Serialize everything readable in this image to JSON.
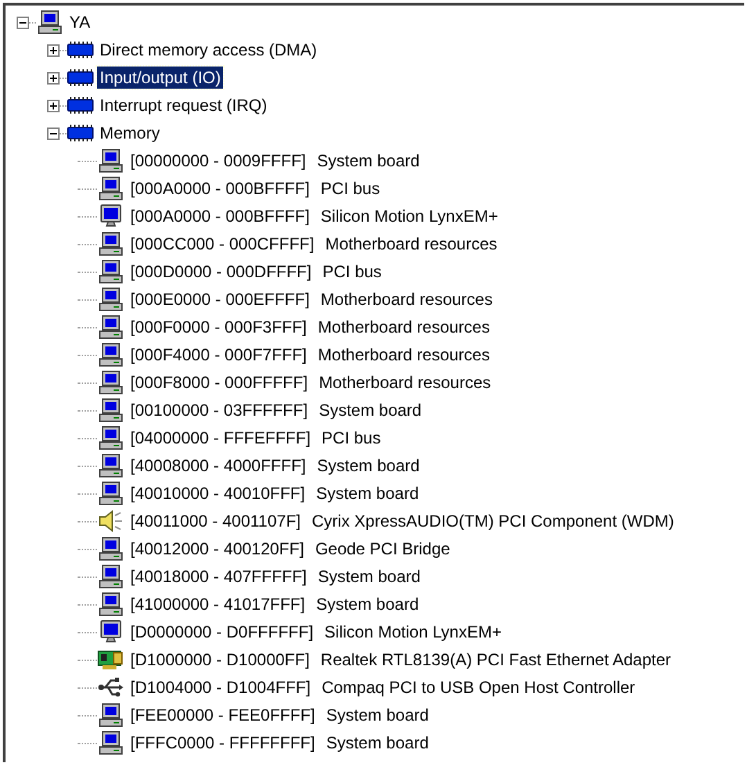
{
  "tree": {
    "label": "YA",
    "kind": "computer",
    "expanded": true,
    "selected": false,
    "children": [
      {
        "label": "Direct memory access (DMA)",
        "kind": "chip",
        "expanded": false,
        "selected": false
      },
      {
        "label": "Input/output (IO)",
        "kind": "chip",
        "expanded": false,
        "selected": true
      },
      {
        "label": "Interrupt request (IRQ)",
        "kind": "chip",
        "expanded": false,
        "selected": false
      },
      {
        "label": "Memory",
        "kind": "chip",
        "expanded": true,
        "selected": false,
        "children": [
          {
            "range": "[00000000 - 0009FFFF]",
            "name": "System board",
            "kind": "computer",
            "selected": false
          },
          {
            "range": "[000A0000 - 000BFFFF]",
            "name": "PCI bus",
            "kind": "computer",
            "selected": false
          },
          {
            "range": "[000A0000 - 000BFFFF]",
            "name": "Silicon Motion LynxEM+",
            "kind": "monitor",
            "selected": false
          },
          {
            "range": "[000CC000 - 000CFFFF]",
            "name": "Motherboard resources",
            "kind": "computer",
            "selected": false
          },
          {
            "range": "[000D0000 - 000DFFFF]",
            "name": "PCI bus",
            "kind": "computer",
            "selected": false
          },
          {
            "range": "[000E0000 - 000EFFFF]",
            "name": "Motherboard resources",
            "kind": "computer",
            "selected": false
          },
          {
            "range": "[000F0000 - 000F3FFF]",
            "name": "Motherboard resources",
            "kind": "computer",
            "selected": false
          },
          {
            "range": "[000F4000 - 000F7FFF]",
            "name": "Motherboard resources",
            "kind": "computer",
            "selected": false
          },
          {
            "range": "[000F8000 - 000FFFFF]",
            "name": "Motherboard resources",
            "kind": "computer",
            "selected": false
          },
          {
            "range": "[00100000 - 03FFFFFF]",
            "name": "System board",
            "kind": "computer",
            "selected": false
          },
          {
            "range": "[04000000 - FFFEFFFF]",
            "name": "PCI bus",
            "kind": "computer",
            "selected": false
          },
          {
            "range": "[40008000 - 4000FFFF]",
            "name": "System board",
            "kind": "computer",
            "selected": false
          },
          {
            "range": "[40010000 - 40010FFF]",
            "name": "System board",
            "kind": "computer",
            "selected": false
          },
          {
            "range": "[40011000 - 4001107F]",
            "name": "Cyrix XpressAUDIO(TM) PCI Component (WDM)",
            "kind": "speaker",
            "selected": false
          },
          {
            "range": "[40012000 - 400120FF]",
            "name": "Geode PCI Bridge",
            "kind": "computer",
            "selected": false
          },
          {
            "range": "[40018000 - 407FFFFF]",
            "name": "System board",
            "kind": "computer",
            "selected": false
          },
          {
            "range": "[41000000 - 41017FFF]",
            "name": "System board",
            "kind": "computer",
            "selected": false
          },
          {
            "range": "[D0000000 - D0FFFFFF]",
            "name": "Silicon Motion LynxEM+",
            "kind": "monitor",
            "selected": false
          },
          {
            "range": "[D1000000 - D10000FF]",
            "name": "Realtek RTL8139(A) PCI Fast Ethernet Adapter",
            "kind": "netcard",
            "selected": false
          },
          {
            "range": "[D1004000 - D1004FFF]",
            "name": "Compaq PCI to USB Open Host Controller",
            "kind": "usb",
            "selected": false
          },
          {
            "range": "[FEE00000 - FEE0FFFF]",
            "name": "System board",
            "kind": "computer",
            "selected": false
          },
          {
            "range": "[FFFC0000 - FFFFFFFF]",
            "name": "System board",
            "kind": "computer",
            "selected": false
          }
        ]
      }
    ]
  }
}
